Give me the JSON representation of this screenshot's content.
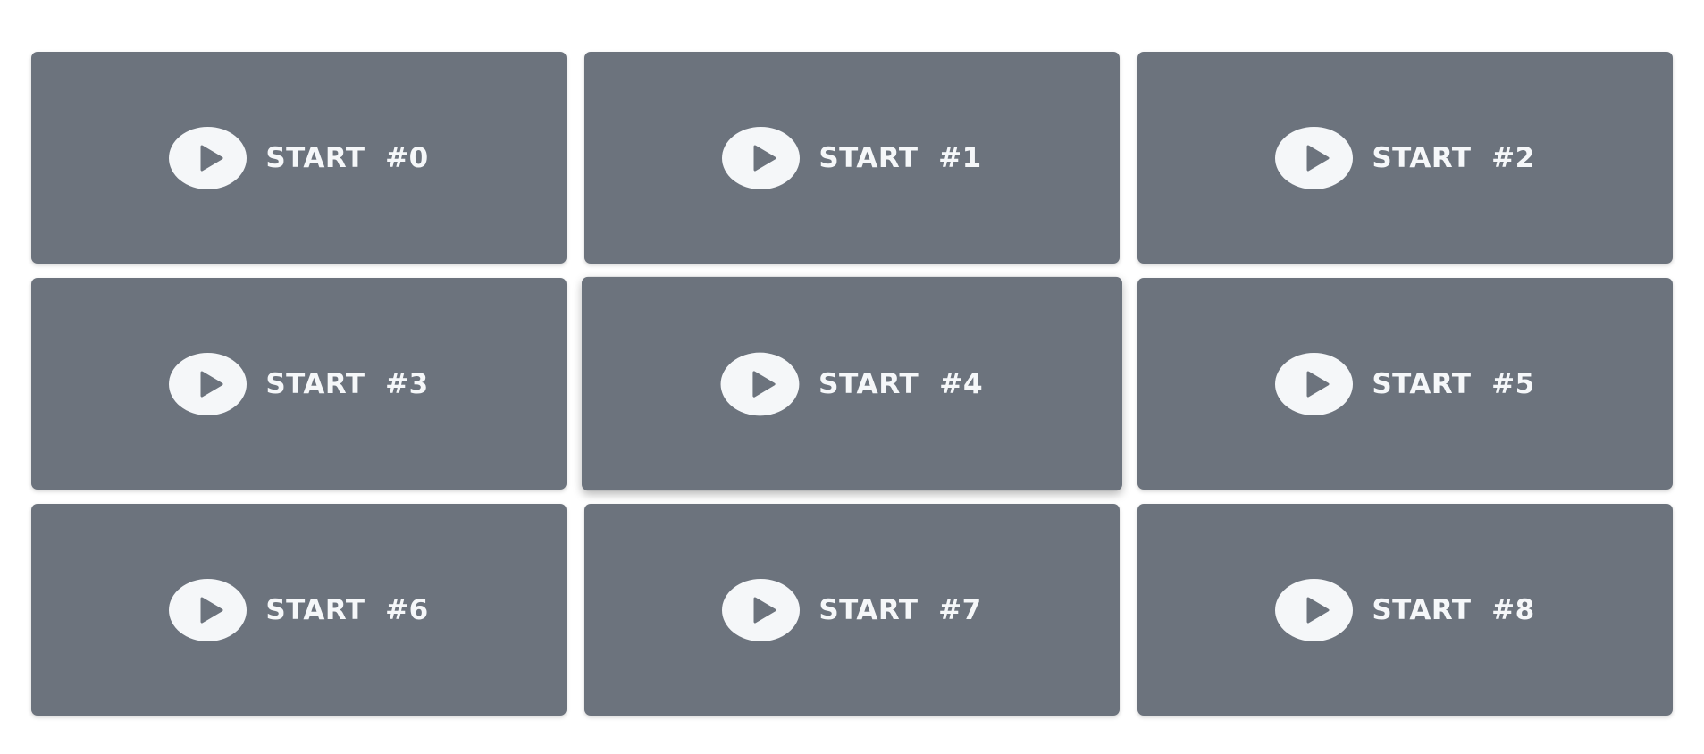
{
  "colors": {
    "tile_background": "#6c737d",
    "icon_circle": "#f5f7f9",
    "icon_triangle": "#6c737d",
    "label_text": "#f5f7f9"
  },
  "tiles": [
    {
      "label": "START  #0",
      "icon": "play-icon"
    },
    {
      "label": "START  #1",
      "icon": "play-icon"
    },
    {
      "label": "START  #2",
      "icon": "play-icon"
    },
    {
      "label": "START  #3",
      "icon": "play-icon"
    },
    {
      "label": "START  #4",
      "icon": "play-icon"
    },
    {
      "label": "START  #5",
      "icon": "play-icon"
    },
    {
      "label": "START  #6",
      "icon": "play-icon"
    },
    {
      "label": "START  #7",
      "icon": "play-icon"
    },
    {
      "label": "START  #8",
      "icon": "play-icon"
    }
  ]
}
